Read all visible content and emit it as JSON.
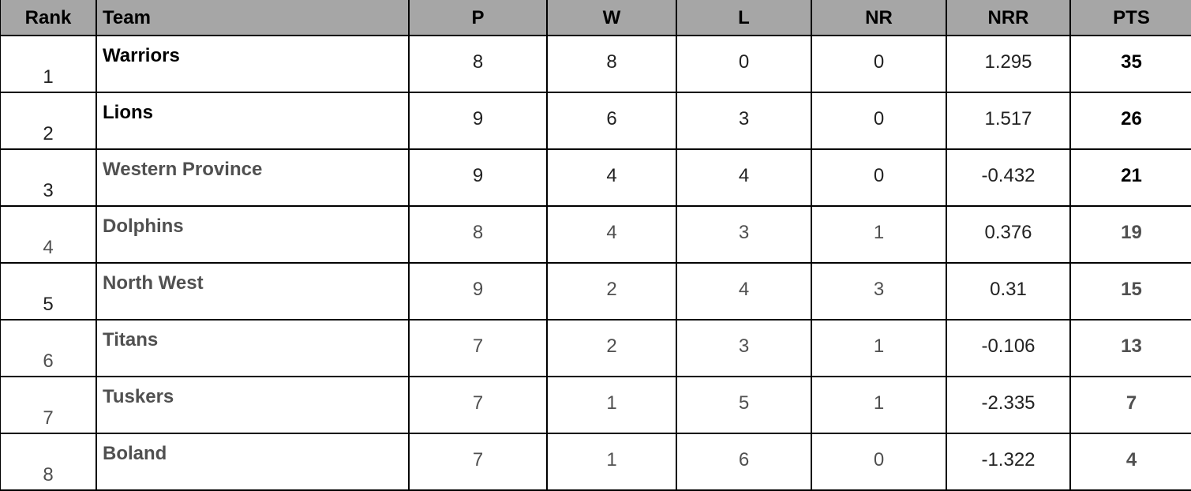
{
  "table": {
    "headers": {
      "rank": "Rank",
      "team": "Team",
      "p": "P",
      "w": "W",
      "l": "L",
      "nr": "NR",
      "nrr": "NRR",
      "pts": "PTS"
    },
    "rows": [
      {
        "rank": "1",
        "team": "Warriors",
        "p": "8",
        "w": "8",
        "l": "0",
        "nr": "0",
        "nrr": "1.295",
        "pts": "35"
      },
      {
        "rank": "2",
        "team": "Lions",
        "p": "9",
        "w": "6",
        "l": "3",
        "nr": "0",
        "nrr": "1.517",
        "pts": "26"
      },
      {
        "rank": "3",
        "team": "Western Province",
        "p": "9",
        "w": "4",
        "l": "4",
        "nr": "0",
        "nrr": "-0.432",
        "pts": "21"
      },
      {
        "rank": "4",
        "team": "Dolphins",
        "p": "8",
        "w": "4",
        "l": "3",
        "nr": "1",
        "nrr": "0.376",
        "pts": "19"
      },
      {
        "rank": "5",
        "team": "North West",
        "p": "9",
        "w": "2",
        "l": "4",
        "nr": "3",
        "nrr": "0.31",
        "pts": "15"
      },
      {
        "rank": "6",
        "team": "Titans",
        "p": "7",
        "w": "2",
        "l": "3",
        "nr": "1",
        "nrr": "-0.106",
        "pts": "13"
      },
      {
        "rank": "7",
        "team": "Tuskers",
        "p": "7",
        "w": "1",
        "l": "5",
        "nr": "1",
        "nrr": "-2.335",
        "pts": "7"
      },
      {
        "rank": "8",
        "team": "Boland",
        "p": "7",
        "w": "1",
        "l": "6",
        "nr": "0",
        "nrr": "-1.322",
        "pts": "4"
      }
    ]
  },
  "colors": {
    "header_bg": "#a6a6a6",
    "border": "#000000",
    "text_primary": "#000000",
    "text_muted": "#505050"
  }
}
